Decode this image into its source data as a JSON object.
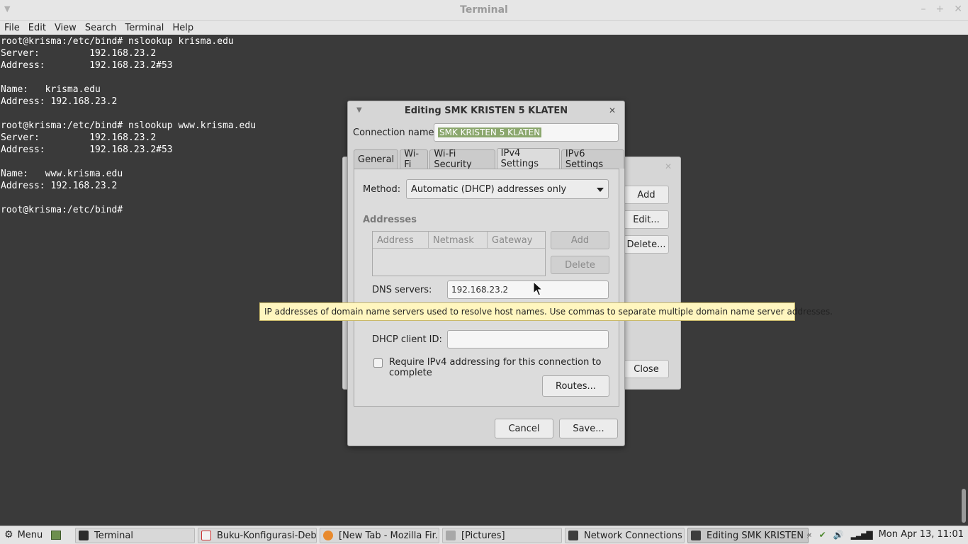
{
  "terminal": {
    "window_title": "Terminal",
    "menu": [
      "File",
      "Edit",
      "View",
      "Search",
      "Terminal",
      "Help"
    ],
    "lines": [
      "root@krisma:/etc/bind# nslookup krisma.edu",
      "Server:         192.168.23.2",
      "Address:        192.168.23.2#53",
      "",
      "Name:   krisma.edu",
      "Address: 192.168.23.2",
      "",
      "root@krisma:/etc/bind# nslookup www.krisma.edu",
      "Server:         192.168.23.2",
      "Address:        192.168.23.2#53",
      "",
      "Name:   www.krisma.edu",
      "Address: 192.168.23.2",
      "",
      "root@krisma:/etc/bind#"
    ]
  },
  "network_connections": {
    "add_label": "Add",
    "edit_label": "Edit...",
    "delete_label": "Delete...",
    "close_label": "Close"
  },
  "editor": {
    "title": "Editing SMK KRISTEN 5 KLATEN",
    "connection_name_label": "Connection name:",
    "connection_name_value": "SMK KRISTEN 5 KLATEN",
    "tabs": [
      "General",
      "Wi-Fi",
      "Wi-Fi Security",
      "IPv4 Settings",
      "IPv6 Settings"
    ],
    "active_tab": "IPv4 Settings",
    "method_label": "Method:",
    "method_value": "Automatic (DHCP) addresses only",
    "addresses_title": "Addresses",
    "address_columns": [
      "Address",
      "Netmask",
      "Gateway"
    ],
    "add_label": "Add",
    "delete_label": "Delete",
    "dns_label": "DNS servers:",
    "dns_value": "192.168.23.2",
    "dhcp_label": "DHCP client ID:",
    "dhcp_value": "",
    "require_label": "Require IPv4 addressing for this connection to complete",
    "require_checked": false,
    "routes_label": "Routes...",
    "cancel_label": "Cancel",
    "save_label": "Save..."
  },
  "tooltip": {
    "text": "IP addresses of domain name servers used to resolve host names. Use commas to separate multiple domain name server addresses."
  },
  "taskbar": {
    "menu_label": "Menu",
    "items": [
      {
        "label": "Terminal",
        "icon": "terminal-icon"
      },
      {
        "label": "Buku-Konfigurasi-Deb...",
        "icon": "document-icon"
      },
      {
        "label": "[New Tab - Mozilla Fir...",
        "icon": "firefox-icon"
      },
      {
        "label": "[Pictures]",
        "icon": "folder-icon"
      },
      {
        "label": "Network Connections",
        "icon": "network-icon"
      },
      {
        "label": "Editing SMK KRISTEN ...",
        "icon": "network-icon"
      }
    ],
    "clock": "Mon Apr 13, 11:01"
  }
}
